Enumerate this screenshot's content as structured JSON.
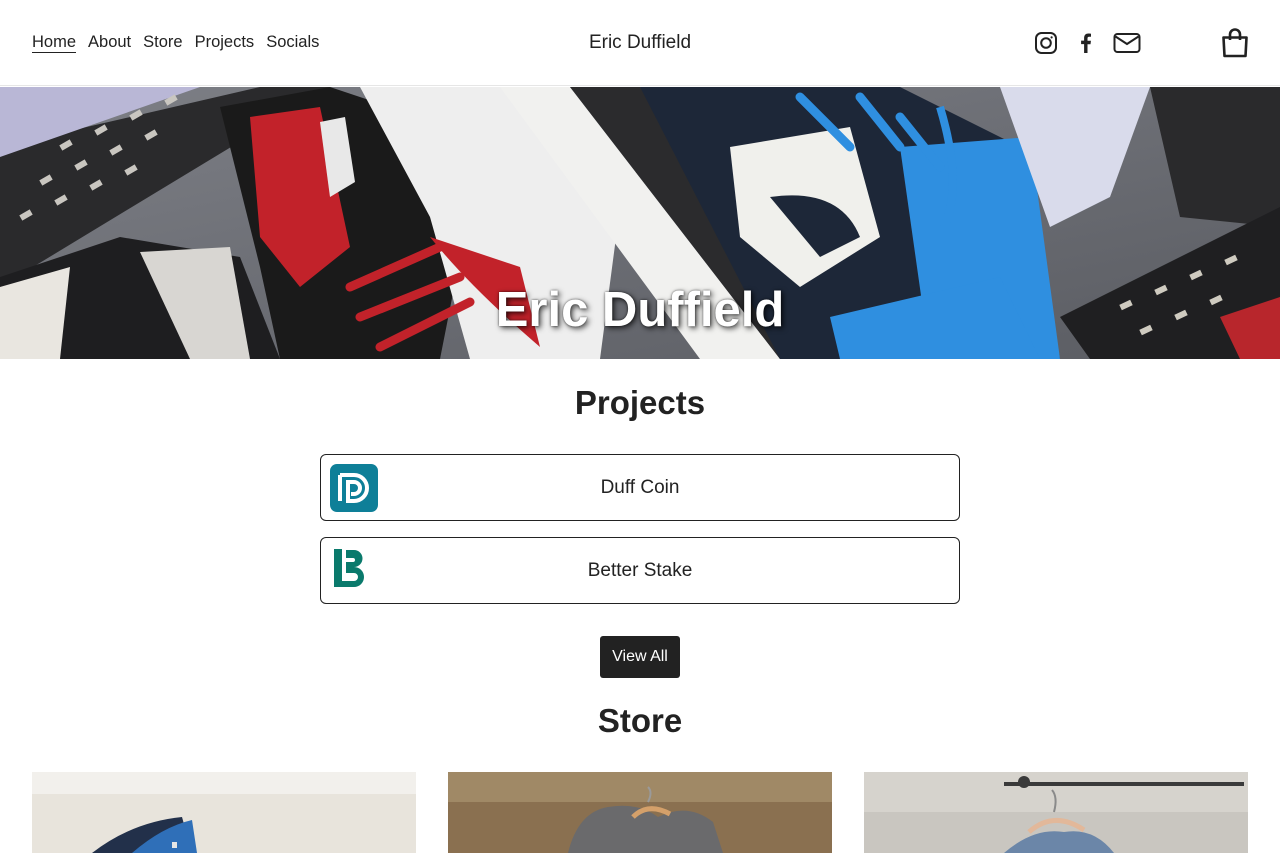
{
  "header": {
    "nav": [
      {
        "label": "Home",
        "active": true
      },
      {
        "label": "About"
      },
      {
        "label": "Store"
      },
      {
        "label": "Projects"
      },
      {
        "label": "Socials"
      }
    ],
    "site_title": "Eric Duffield",
    "social_icons": [
      "instagram-icon",
      "facebook-icon",
      "mail-icon"
    ],
    "cart_icon": "shopping-bag-icon"
  },
  "hero": {
    "title": "Eric Duffield"
  },
  "projects": {
    "heading": "Projects",
    "items": [
      {
        "label": "Duff Coin",
        "logo_icon": "duff-coin-logo",
        "logo_color": "#0e7f98"
      },
      {
        "label": "Better Stake",
        "logo_icon": "better-stake-logo",
        "logo_color": "#0a7a6c"
      }
    ],
    "view_all_label": "View All"
  },
  "store": {
    "heading": "Store"
  },
  "colors": {
    "text": "#222222",
    "button_bg": "#222222",
    "button_text": "#ffffff"
  }
}
